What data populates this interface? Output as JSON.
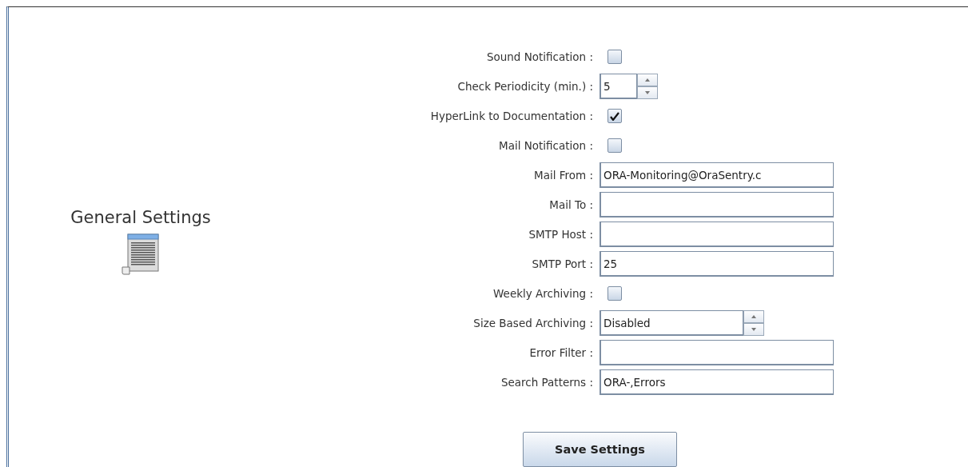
{
  "section": {
    "title": "General Settings"
  },
  "settings": [
    {
      "kind": "checkbox",
      "label": "Sound Notification :",
      "checked": false
    },
    {
      "kind": "spinner",
      "label": "Check Periodicity (min.) :",
      "value": "5"
    },
    {
      "kind": "checkbox",
      "label": "HyperLink to Documentation :",
      "checked": true
    },
    {
      "kind": "checkbox",
      "label": "Mail Notification :",
      "checked": false
    },
    {
      "kind": "text",
      "label": "Mail From :",
      "value": "ORA-Monitoring@OraSentry.c"
    },
    {
      "kind": "text",
      "label": "Mail To :"
    },
    {
      "kind": "text",
      "label": "SMTP Host :"
    },
    {
      "kind": "text",
      "label": "SMTP Port :",
      "value": "25"
    },
    {
      "kind": "checkbox",
      "label": "Weekly Archiving :",
      "checked": false
    },
    {
      "kind": "wide-spinner",
      "label": "Size Based Archiving :",
      "value": "Disabled"
    },
    {
      "kind": "text",
      "label": "Error Filter :"
    },
    {
      "kind": "text",
      "label": "Search Patterns :",
      "value": "ORA-,Errors"
    }
  ],
  "save_button": "Save Settings"
}
